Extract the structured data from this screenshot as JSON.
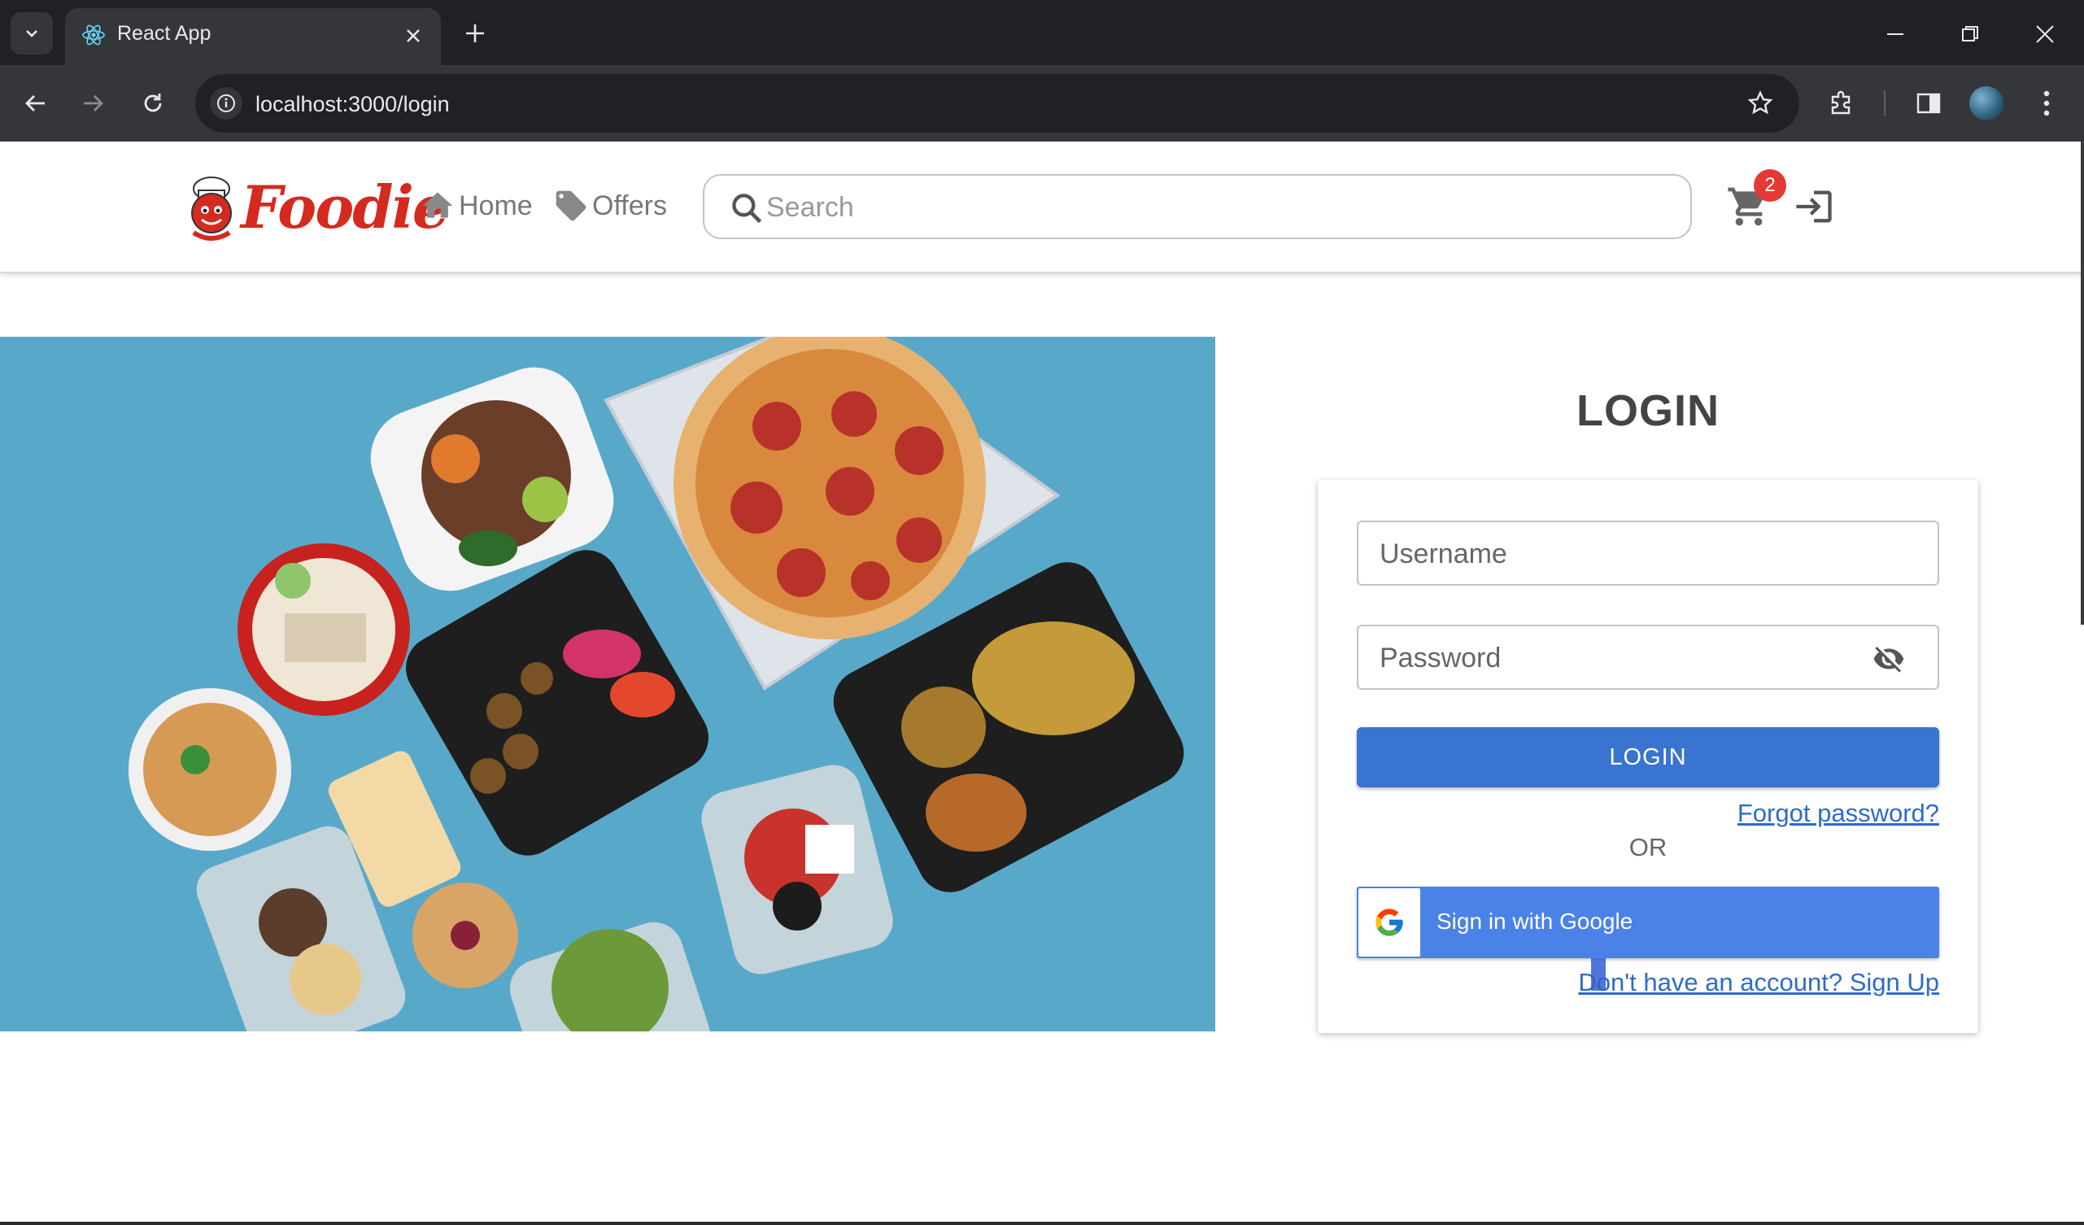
{
  "browser": {
    "tab_title": "React App",
    "url": "localhost:3000/login"
  },
  "header": {
    "logo_text": "Foodie",
    "nav": [
      {
        "label": "Home",
        "icon": "home-icon"
      },
      {
        "label": "Offers",
        "icon": "tag-icon"
      }
    ],
    "search_placeholder": "Search",
    "cart_count": "2"
  },
  "login": {
    "title": "LOGIN",
    "username_placeholder": "Username",
    "password_placeholder": "Password",
    "login_button": "LOGIN",
    "forgot_password": "Forgot password?",
    "or_text": "OR",
    "google_button": "Sign in with Google",
    "signup_link": "Don't have an account? Sign Up"
  },
  "colors": {
    "brand_red": "#d42a1f",
    "primary_blue": "#3874d0",
    "google_blue": "#4a82e7",
    "link_blue": "#2f6bcb",
    "hero_bg": "#58a9c9"
  }
}
